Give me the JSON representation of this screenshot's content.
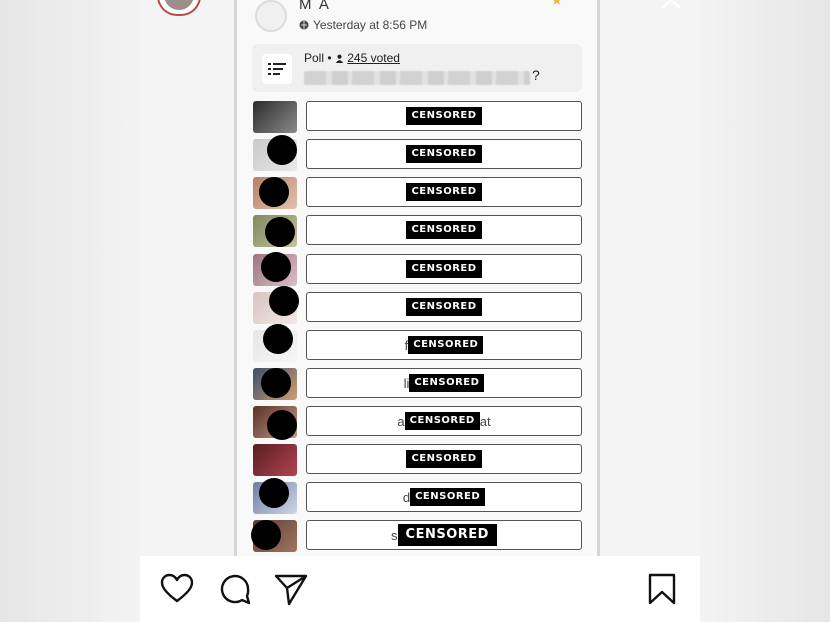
{
  "post": {
    "author": "M A",
    "timestamp": "Yesterday at 8:56 PM"
  },
  "poll": {
    "label": "Poll",
    "separator": "•",
    "voted": "245 voted",
    "question_end": "?"
  },
  "options": [
    {
      "left": "",
      "censor": "CENSORED",
      "right": "",
      "big": false
    },
    {
      "left": "",
      "censor": "CENSORED",
      "right": "",
      "big": false
    },
    {
      "left": "",
      "censor": "CENSORED",
      "right": "",
      "big": false
    },
    {
      "left": "",
      "censor": "CENSORED",
      "right": "",
      "big": false
    },
    {
      "left": "",
      "censor": "CENSORED",
      "right": "",
      "big": false
    },
    {
      "left": "",
      "censor": "CENSORED",
      "right": "",
      "big": false
    },
    {
      "left": "f",
      "censor": "CENSORED",
      "right": "",
      "big": false
    },
    {
      "left": "li",
      "censor": "CENSORED",
      "right": "",
      "big": false
    },
    {
      "left": "a",
      "censor": "CENSORED",
      "right": "at",
      "big": false
    },
    {
      "left": "",
      "censor": "CENSORED",
      "right": "",
      "big": false
    },
    {
      "left": "d",
      "censor": "CENSORED",
      "right": "",
      "big": false
    },
    {
      "left": "s",
      "censor": "CENSORED",
      "right": "",
      "big": true
    }
  ],
  "icons": {
    "like": "heart-icon",
    "comment": "comment-icon",
    "share": "send-icon",
    "save": "bookmark-icon",
    "close": "close-icon"
  }
}
